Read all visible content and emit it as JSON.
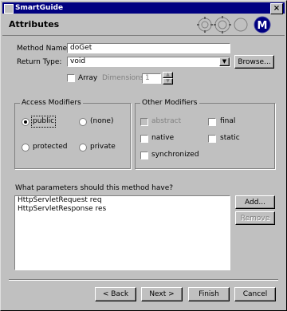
{
  "window": {
    "title": "SmartGuide"
  },
  "header": {
    "title": "Attributes"
  },
  "form": {
    "method_name_label": "Method Name:",
    "method_name_value": "doGet",
    "return_type_label": "Return Type:",
    "return_type_value": "void",
    "browse_label": "Browse...",
    "array_label": "Array",
    "dimensions_label": "Dimensions:",
    "dimensions_value": "1"
  },
  "access_modifiers": {
    "title": "Access Modifiers",
    "options": [
      "public",
      "(none)",
      "protected",
      "private"
    ],
    "selected": "public"
  },
  "other_modifiers": {
    "title": "Other Modifiers",
    "options": [
      "abstract",
      "final",
      "native",
      "static",
      "synchronized"
    ]
  },
  "parameters": {
    "question": "What parameters should this method have?",
    "items": [
      "HttpServletRequest req",
      "HttpServletResponse res"
    ],
    "add_label": "Add...",
    "remove_label": "Remove"
  },
  "footer": {
    "back_label": "< Back",
    "next_label": "Next >",
    "finish_label": "Finish",
    "cancel_label": "Cancel"
  }
}
